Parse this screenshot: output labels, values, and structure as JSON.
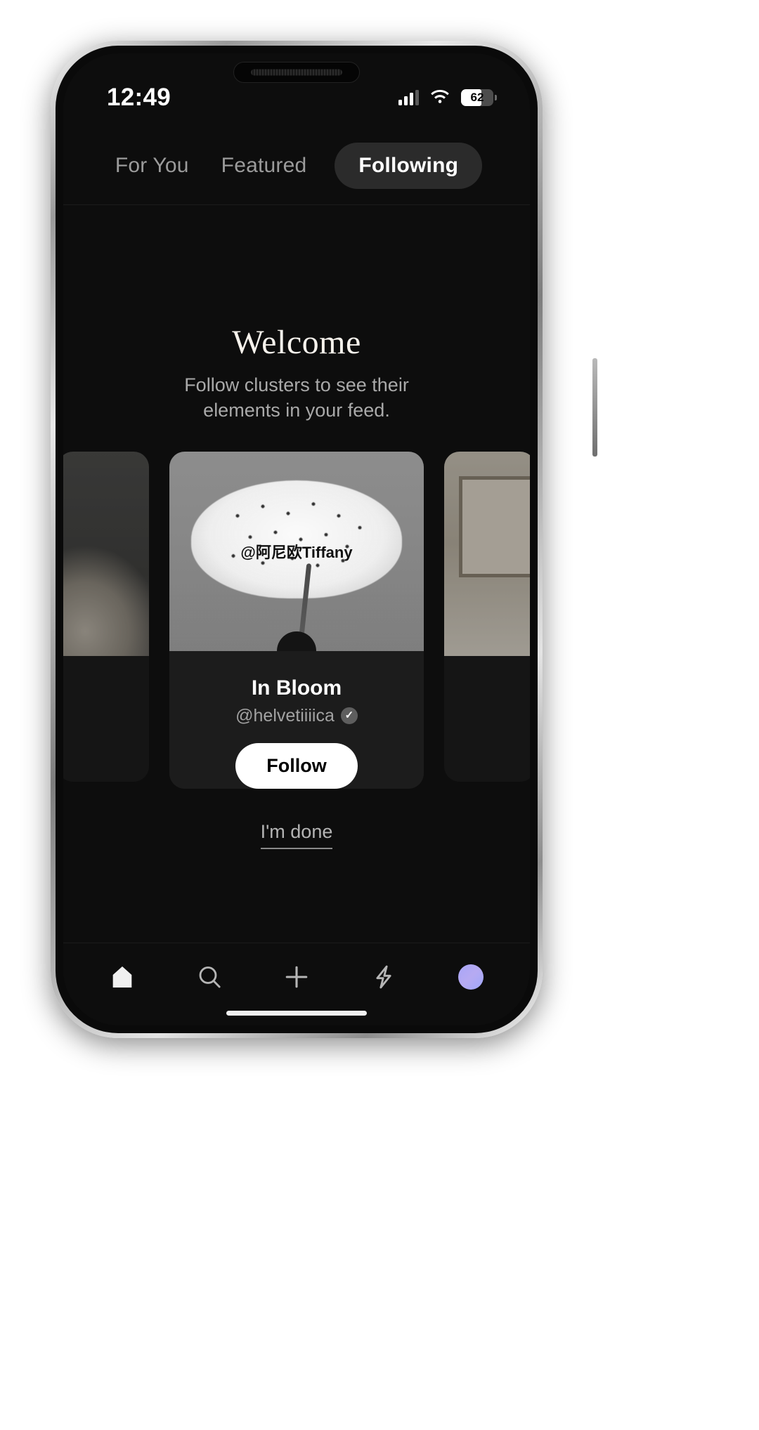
{
  "status_bar": {
    "time": "12:49",
    "battery_percent": "62",
    "cellular_icon": "cellular-bars-icon",
    "wifi_icon": "wifi-icon",
    "battery_icon": "battery-icon"
  },
  "top_tabs": [
    {
      "label": "For You",
      "active": false
    },
    {
      "label": "Featured",
      "active": false
    },
    {
      "label": "Following",
      "active": true
    }
  ],
  "main": {
    "title": "Welcome",
    "subtitle": "Follow clusters to see their elements in your feed.",
    "done_link": "I'm done"
  },
  "card": {
    "watermark": "@阿尼欧Tiffany",
    "title": "In Bloom",
    "handle": "@helvetiiiica",
    "verified_glyph": "✓",
    "follow_label": "Follow"
  },
  "bottom_nav": [
    {
      "name": "home-icon",
      "label": "Home",
      "active": true
    },
    {
      "name": "search-icon",
      "label": "Search",
      "active": false
    },
    {
      "name": "plus-icon",
      "label": "Create",
      "active": false
    },
    {
      "name": "lightning-icon",
      "label": "Activity",
      "active": false
    },
    {
      "name": "profile-avatar",
      "label": "Profile",
      "active": false
    }
  ],
  "colors": {
    "background": "#0d0d0d",
    "card": "#1c1c1c",
    "active_pill": "#2b2b2b",
    "accent_white": "#ffffff",
    "muted_text": "#a9a9a9",
    "avatar_gradient": "#a8a6f8"
  }
}
